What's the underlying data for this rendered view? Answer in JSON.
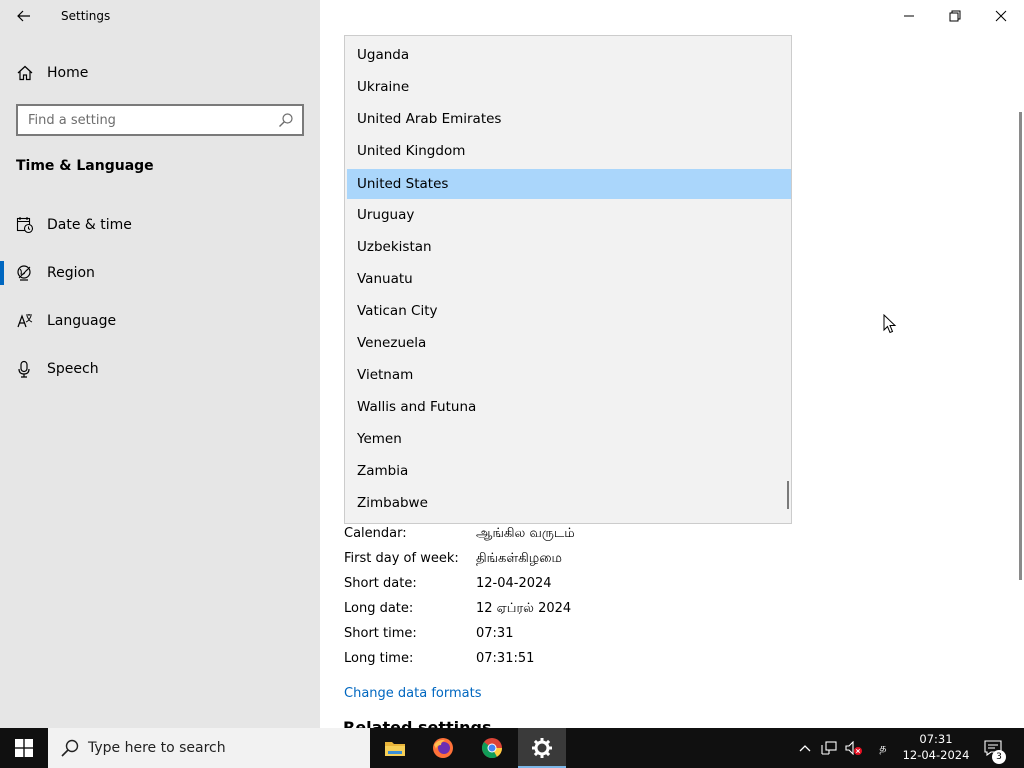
{
  "app": {
    "title": "Settings"
  },
  "sidebar": {
    "home_label": "Home",
    "search_placeholder": "Find a setting",
    "section_title": "Time & Language",
    "items": [
      {
        "label": "Date & time",
        "icon": "calendar-clock-icon",
        "active": false
      },
      {
        "label": "Region",
        "icon": "globe-icon",
        "active": true
      },
      {
        "label": "Language",
        "icon": "language-icon",
        "active": false
      },
      {
        "label": "Speech",
        "icon": "microphone-icon",
        "active": false
      }
    ]
  },
  "country_dropdown": {
    "options": [
      "Uganda",
      "Ukraine",
      "United Arab Emirates",
      "United Kingdom",
      "United States",
      "Uruguay",
      "Uzbekistan",
      "Vanuatu",
      "Vatican City",
      "Venezuela",
      "Vietnam",
      "Wallis and Futuna",
      "Yemen",
      "Zambia",
      "Zimbabwe"
    ],
    "selected": "United States"
  },
  "regional_format": {
    "rows": [
      {
        "label": "Calendar:",
        "value": "ஆங்கில வருடம்"
      },
      {
        "label": "First day of week:",
        "value": "திங்கள்கிழமை"
      },
      {
        "label": "Short date:",
        "value": "12-04-2024"
      },
      {
        "label": "Long date:",
        "value": "12 ஏப்ரல் 2024"
      },
      {
        "label": "Short time:",
        "value": "07:31"
      },
      {
        "label": "Long time:",
        "value": "07:31:51"
      }
    ],
    "change_link": "Change data formats"
  },
  "related_settings_partial": "Related settings",
  "taskbar": {
    "search_placeholder": "Type here to search",
    "apps": [
      "file-explorer-icon",
      "firefox-icon",
      "chrome-icon",
      "settings-icon"
    ],
    "ime_indicator": "த",
    "time": "07:31",
    "date": "12-04-2024",
    "notification_count": "3"
  },
  "colors": {
    "accent": "#0067c0",
    "selected_item": "#aad6fb",
    "sidebar_bg": "#e6e6e6",
    "taskbar_bg": "#101010"
  }
}
